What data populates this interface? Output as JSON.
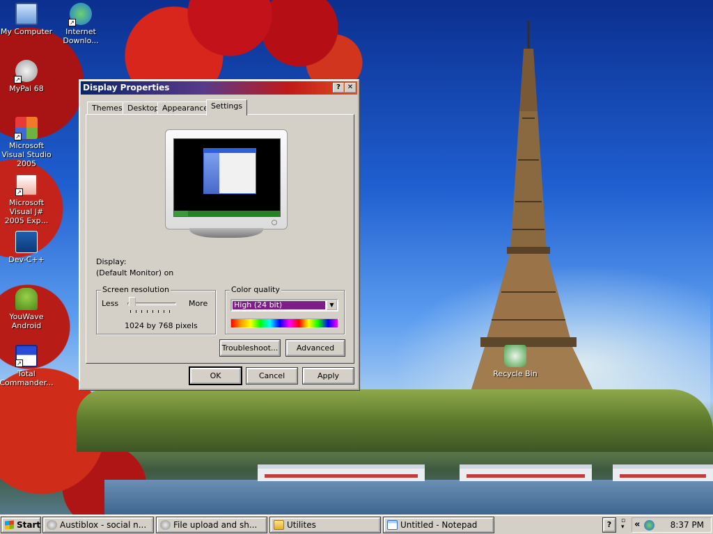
{
  "desktop": {
    "icons": [
      {
        "label": "My Computer",
        "icon": "my-computer-icon"
      },
      {
        "label": "Internet Downlo...",
        "icon": "internet-download-manager-icon"
      },
      {
        "label": "MyPal 68",
        "icon": "mypal-icon"
      },
      {
        "label": "Microsoft Visual Studio 2005",
        "icon": "visual-studio-icon"
      },
      {
        "label": "Microsoft Visual J# 2005 Exp...",
        "icon": "visual-jsharp-icon"
      },
      {
        "label": "Dev-C++",
        "icon": "dev-cpp-icon"
      },
      {
        "label": "YouWave Android",
        "icon": "youwave-android-icon"
      },
      {
        "label": "Total Commander...",
        "icon": "total-commander-icon"
      },
      {
        "label": "Recycle Bin",
        "icon": "recycle-bin-icon"
      }
    ]
  },
  "dialog": {
    "title": "Display Properties",
    "help_button": "?",
    "close_button": "✕",
    "tabs": [
      "Themes",
      "Desktop",
      "Appearance",
      "Settings"
    ],
    "active_tab": "Settings",
    "display_label": "Display:",
    "display_value": "(Default Monitor) on",
    "resolution": {
      "legend": "Screen resolution",
      "less": "Less",
      "more": "More",
      "value_text": "1024 by 768 pixels",
      "slider_position": 0.1
    },
    "color_quality": {
      "legend": "Color quality",
      "selected": "High (24 bit)",
      "dropdown_arrow": "▼"
    },
    "buttons": {
      "troubleshoot": "Troubleshoot...",
      "advanced": "Advanced",
      "ok": "OK",
      "cancel": "Cancel",
      "apply": "Apply"
    }
  },
  "taskbar": {
    "start_label": "Start",
    "tasks": [
      {
        "label": "Austiblox - social n...",
        "icon": "mypal-icon"
      },
      {
        "label": "File upload and sh...",
        "icon": "mypal-icon"
      },
      {
        "label": "Utilites",
        "icon": "folder-icon"
      },
      {
        "label": "Untitled - Notepad",
        "icon": "notepad-icon"
      }
    ],
    "tray": {
      "expand": "«",
      "clock": "8:37 PM",
      "help_icon": "?"
    }
  },
  "colors": {
    "titlebar_start": "#0a246a",
    "titlebar_end": "#e05020",
    "window_face": "#d4d0c8",
    "selection": "#7e1f88"
  }
}
